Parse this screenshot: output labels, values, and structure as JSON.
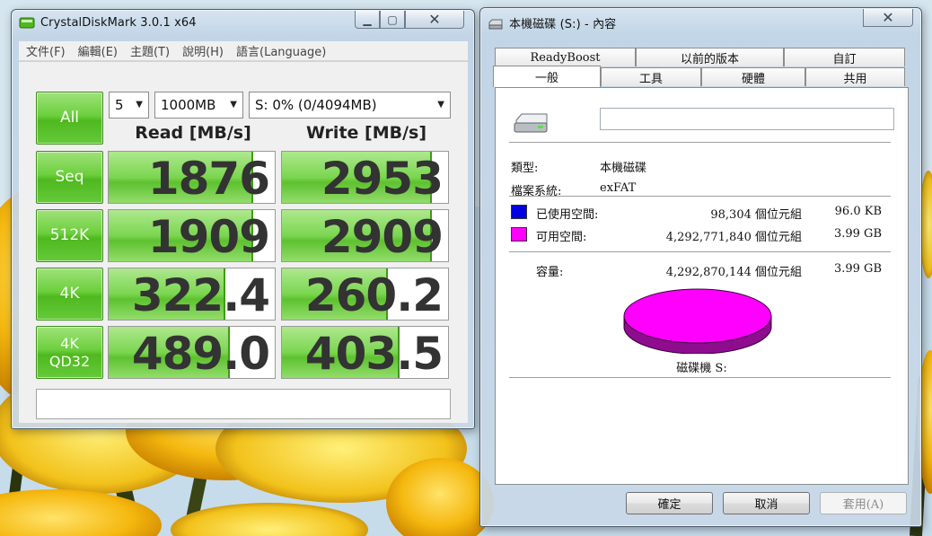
{
  "crystaldiskmark": {
    "title": "CrystalDiskMark 3.0.1 x64",
    "menu": [
      "文件(F)",
      "編輯(E)",
      "主題(T)",
      "說明(H)",
      "語言(Language)"
    ],
    "all_button": "All",
    "count_select": "5",
    "size_select": "1000MB",
    "drive_select": "S: 0% (0/4094MB)",
    "read_header": "Read [MB/s]",
    "write_header": "Write [MB/s]",
    "rows": [
      {
        "label": "Seq",
        "read": "1876",
        "write": "2953",
        "read_fill": 0.87,
        "write_fill": 0.9
      },
      {
        "label": "512K",
        "read": "1909",
        "write": "2909",
        "read_fill": 0.87,
        "write_fill": 0.9
      },
      {
        "label": "4K",
        "read": "322.4",
        "write": "260.2",
        "read_fill": 0.7,
        "write_fill": 0.64
      },
      {
        "label": "4K\nQD32",
        "read": "489.0",
        "write": "403.5",
        "read_fill": 0.73,
        "write_fill": 0.71
      }
    ],
    "comment": ""
  },
  "properties": {
    "title": "本機磁碟 (S:) - 內容",
    "tabs_back": [
      "ReadyBoost",
      "以前的版本",
      "自訂"
    ],
    "tabs_front": [
      "一般",
      "工具",
      "硬體",
      "共用"
    ],
    "drive_name": "",
    "type_label": "類型:",
    "type_value": "本機磁碟",
    "fs_label": "檔案系統:",
    "fs_value": "exFAT",
    "used_label": "已使用空間:",
    "used_bytes": "98,304 個位元組",
    "used_size": "96.0 KB",
    "free_label": "可用空間:",
    "free_bytes": "4,292,771,840 個位元組",
    "free_size": "3.99 GB",
    "capacity_label": "容量:",
    "capacity_bytes": "4,292,870,144 個位元組",
    "capacity_size": "3.99 GB",
    "drive_label": "磁碟機 S:",
    "used_color": "#0000e0",
    "free_color": "#ff00ff",
    "buttons": {
      "ok": "確定",
      "cancel": "取消",
      "apply": "套用(A)"
    }
  }
}
